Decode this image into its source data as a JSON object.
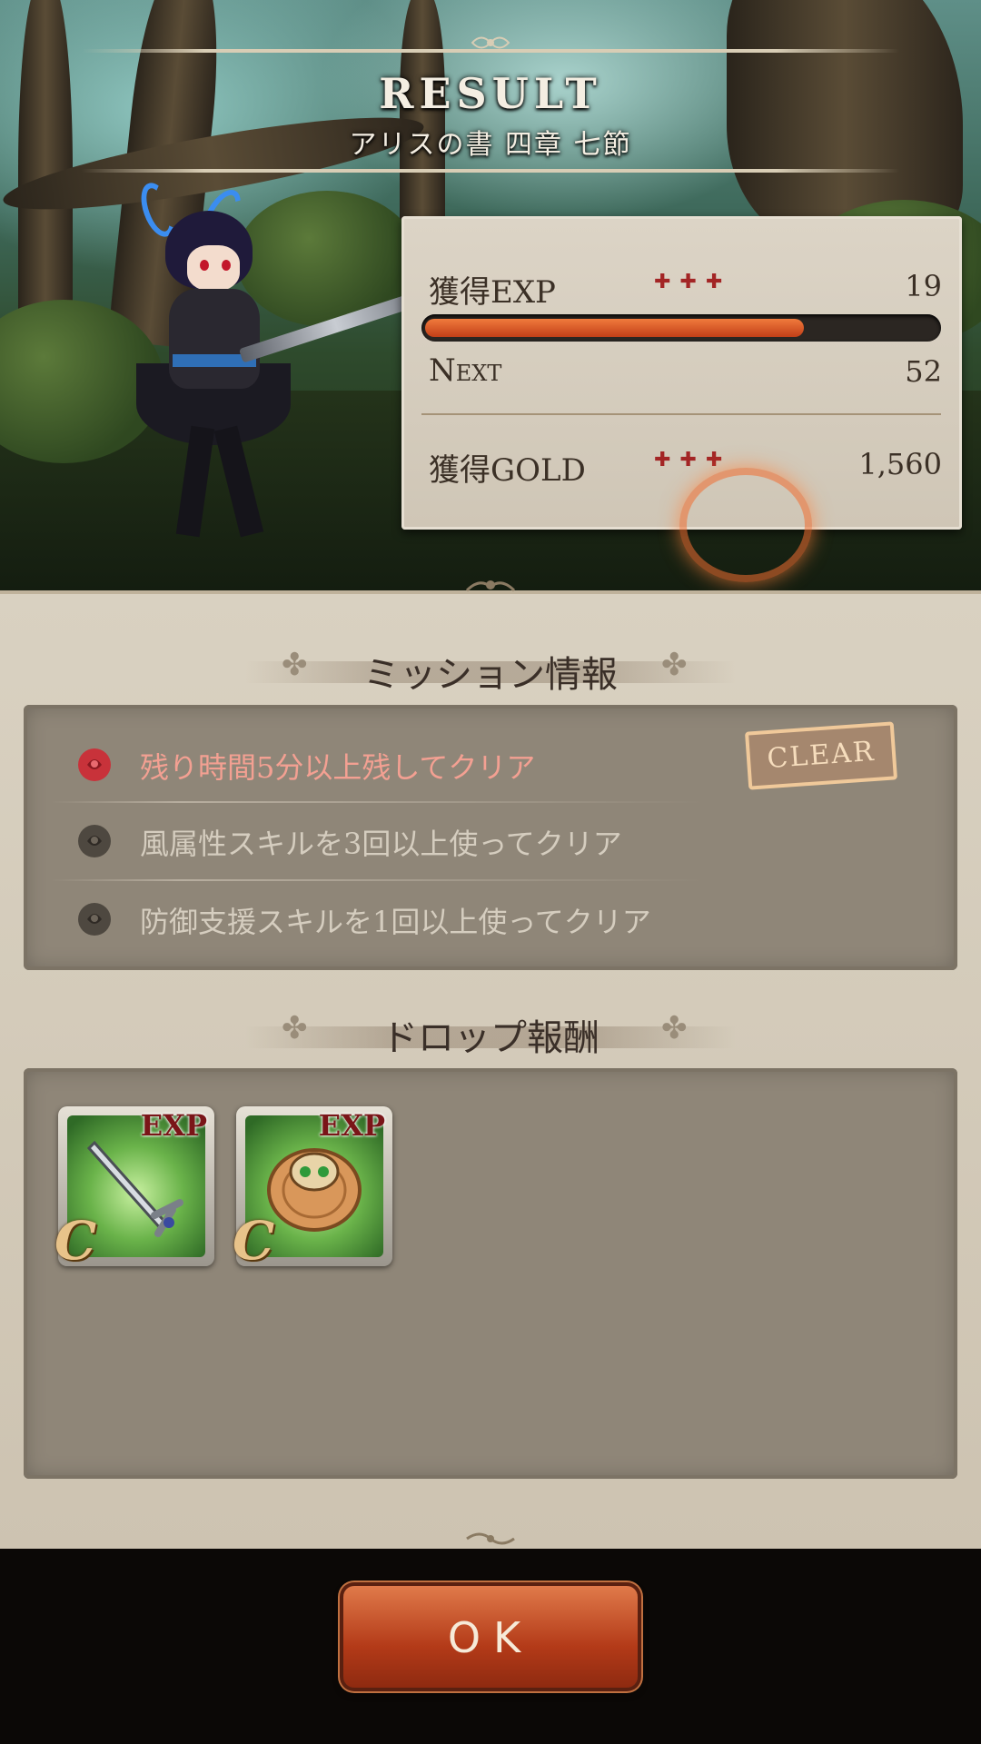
{
  "header": {
    "title": "RESULT",
    "subtitle": "アリスの書 四章 七節"
  },
  "stats": {
    "exp_label": "獲得EXP",
    "exp_value": "19",
    "exp_progress": 0.74,
    "next_label": "Next",
    "next_value": "52",
    "gold_label": "獲得GOLD",
    "gold_value": "1,560",
    "marker_color": "#a32525"
  },
  "missions": {
    "title": "ミッション情報",
    "items": [
      {
        "text": "残り時間5分以上残してクリア",
        "cleared": true
      },
      {
        "text": "風属性スキルを3回以上使ってクリア",
        "cleared": false
      },
      {
        "text": "防御支援スキルを1回以上使ってクリア",
        "cleared": false
      }
    ],
    "clear_stamp": "CLEAR"
  },
  "drops": {
    "title": "ドロップ報酬",
    "items": [
      {
        "icon": "sword-icon",
        "tag": "EXP",
        "rank": "C"
      },
      {
        "icon": "shield-icon",
        "tag": "EXP",
        "rank": "C"
      }
    ]
  },
  "ok_button": {
    "label": "OK"
  },
  "colors": {
    "accent": "#c23f18",
    "parchment": "#d9d1c1",
    "mission_box": "#8f8678",
    "cleared_text": "#f3a092"
  }
}
